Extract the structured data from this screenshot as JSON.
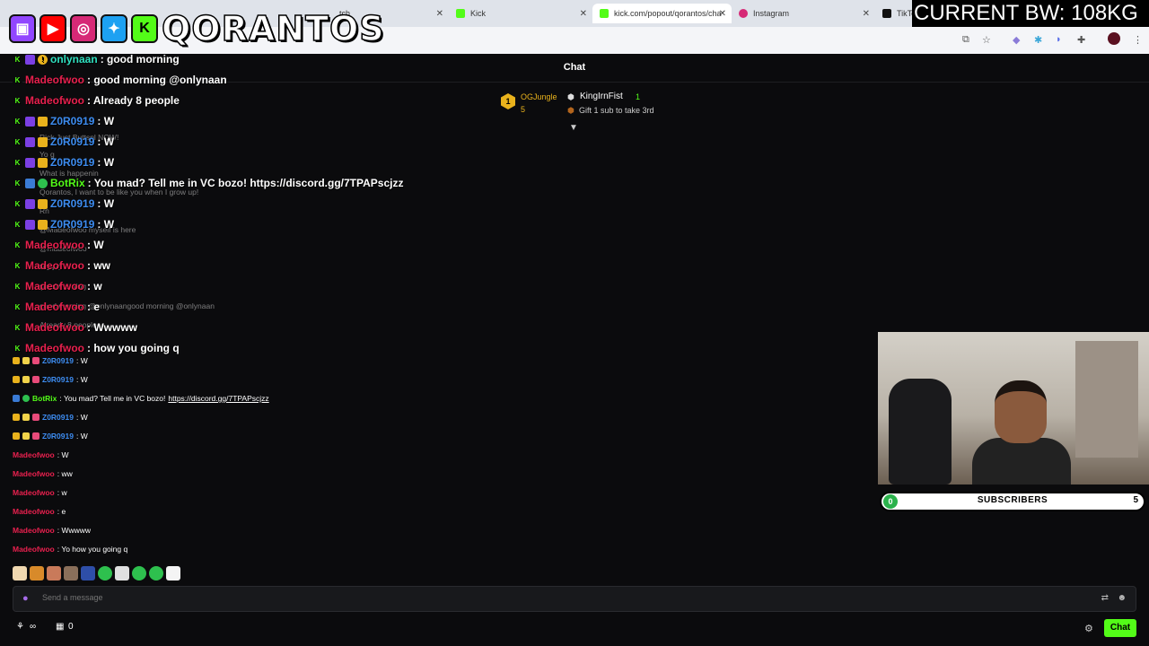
{
  "browser": {
    "tabs": [
      {
        "label": "tch",
        "active": false
      },
      {
        "label": "Kick",
        "active": false
      },
      {
        "label": "kick.com/popout/qorantos/cha",
        "active": true
      },
      {
        "label": "Instagram",
        "active": false
      },
      {
        "label": "TikTo",
        "active": false
      }
    ]
  },
  "overlay": {
    "brand_name": "QORANTOS",
    "bandwidth": "CURRENT BW: 108KG",
    "subscribers_label": "SUBSCRIBERS",
    "subscribers_current": "0",
    "subscribers_goal": "5"
  },
  "chat": {
    "title": "Chat",
    "leaderboard": {
      "first_name": "OGJungle",
      "first_count": "5",
      "second_name": "KingIrnFist",
      "second_count": "1",
      "gift_text": "Gift 1 sub to take 3rd"
    },
    "big_messages": [
      {
        "user": "onlynaan",
        "text": ": good morning"
      },
      {
        "user": "Madeofwoo",
        "text": ": good morning @onlynaan"
      },
      {
        "user": "Madeofwoo",
        "text": ": Already 8 people"
      },
      {
        "user": "Z0R0919",
        "text": ": W"
      },
      {
        "user": "Z0R0919",
        "text": ": W"
      },
      {
        "user": "Z0R0919",
        "text": ": W"
      },
      {
        "user": "BotRix",
        "text": ": You mad? Tell me in VC bozo! https://discord.gg/7TPAPscjzz"
      },
      {
        "user": "Z0R0919",
        "text": ": W"
      },
      {
        "user": "Z0R0919",
        "text": ": W"
      },
      {
        "user": "Madeofwoo",
        "text": ": W"
      },
      {
        "user": "Madeofwoo",
        "text": ": ww"
      },
      {
        "user": "Madeofwoo",
        "text": ": w"
      },
      {
        "user": "Madeofwoo",
        "text": ": e"
      },
      {
        "user": "Madeofwoo",
        "text": ": Wwwww"
      },
      {
        "user": "Madeofwoo",
        "text": ": how you going q"
      }
    ],
    "ghost_messages": [
      {
        "text": "Rick Just Buttsnl NOW!"
      },
      {
        "text": "Yo g"
      },
      {
        "text": "What is happenin"
      },
      {
        "text": "Qorantos, I want to be like you when I grow up!"
      },
      {
        "text": "Rn"
      },
      {
        "text": "@Madeofwoo myself is here"
      },
      {
        "text": "@madeofwoo"
      },
      {
        "text": "NOW!"
      },
      {
        "text": "good morning"
      },
      {
        "text": "good morning @onlynaangood morning @onlynaan"
      },
      {
        "text": "Already 8 people"
      }
    ],
    "small_messages": [
      {
        "user": "Z0R0919",
        "text": ": W"
      },
      {
        "user": "Z0R0919",
        "text": ": W"
      },
      {
        "user": "BotRix",
        "text": ": You mad? Tell me in VC bozo! ",
        "link": "https://discord.gg/7TPAPscjzz"
      },
      {
        "user": "Z0R0919",
        "text": ": W"
      },
      {
        "user": "Z0R0919",
        "text": ": W"
      },
      {
        "user": "Madeofwoo",
        "text": ": W"
      },
      {
        "user": "Madeofwoo",
        "text": ": ww"
      },
      {
        "user": "Madeofwoo",
        "text": ": w"
      },
      {
        "user": "Madeofwoo",
        "text": ": e"
      },
      {
        "user": "Madeofwoo",
        "text": ": Wwwww"
      },
      {
        "user": "Madeofwoo",
        "text": ": Yo how you going q"
      }
    ],
    "input_placeholder": "Send a message",
    "footer_count_a": "∞",
    "footer_count_b": "0",
    "chat_button": "Chat"
  },
  "colors": {
    "kick_green": "#53fc18",
    "madeofwoo": "#e8204e",
    "zoro": "#3d8cf0",
    "onlynaan": "#2fe0c0"
  }
}
